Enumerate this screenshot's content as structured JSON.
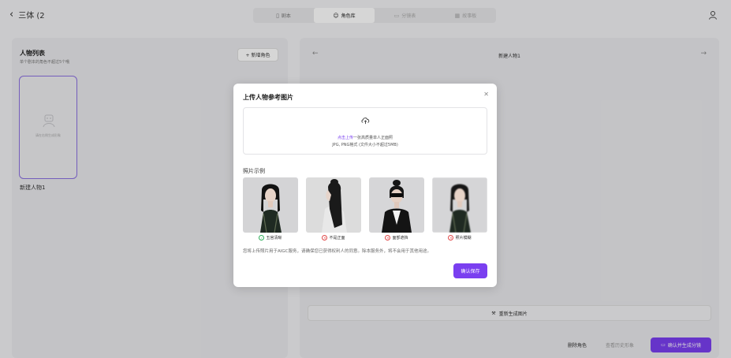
{
  "header": {
    "back_icon": "chevron-left-icon",
    "project_title": "三体 (2",
    "tabs": [
      {
        "label": "剧本",
        "icon": "book-icon",
        "state": "normal"
      },
      {
        "label": "角色库",
        "icon": "smiley-icon",
        "state": "active"
      },
      {
        "label": "分镜表",
        "icon": "storyboard-icon",
        "state": "disabled"
      },
      {
        "label": "故事板",
        "icon": "grid-icon",
        "state": "disabled"
      }
    ],
    "user_icon": "user-icon"
  },
  "left_panel": {
    "title": "人物列表",
    "subtitle": "单个剧本的角色不超过5个哦",
    "add_button": "+ 新增角色",
    "card": {
      "placeholder_text": "请在右侧生成形象",
      "name": "新建人物1"
    }
  },
  "right_panel": {
    "title": "新建人物1",
    "prev_icon": "arrow-left-icon",
    "next_icon": "arrow-right-icon",
    "regenerate_label": "重新生成图片",
    "delete_label": "删除角色",
    "history_label": "查看历史形象",
    "confirm_label": "确认并生成分镜"
  },
  "modal": {
    "title": "上传人物参考图片",
    "close_icon": "close-icon",
    "upload": {
      "link_text": "点击上传",
      "hint_text": "一张高质量单人正面照",
      "format_text": "JPG, PNG格式 (文件大小不超过5MB)"
    },
    "examples_title": "照片示例",
    "examples": [
      {
        "caption": "五官清晰",
        "status": "ok"
      },
      {
        "caption": "不是正面",
        "status": "bad"
      },
      {
        "caption": "面部遮挡",
        "status": "bad"
      },
      {
        "caption": "照片模糊",
        "status": "bad"
      }
    ],
    "disclaimer": "您将上传照片用于AIGC服务，请确保您已获得权利人的同意。除本服务外，将不会用于其他用途。",
    "save_button": "确认保存"
  },
  "colors": {
    "accent": "#7a3ff0",
    "ok": "#2fae5a",
    "bad": "#e04848"
  }
}
